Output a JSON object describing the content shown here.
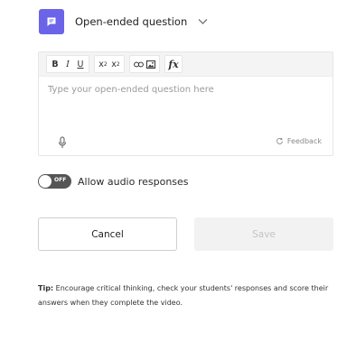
{
  "question_type": {
    "label": "Open-ended question",
    "icon": "speech-bubble-icon",
    "accent": "#6b63e8"
  },
  "toolbar": {
    "bold": "B",
    "italic": "I",
    "underline": "U",
    "superscript": "x",
    "superscript_mark": "2",
    "subscript": "x",
    "subscript_mark": "2",
    "formula": "fx"
  },
  "editor": {
    "placeholder": "Type your open-ended question here",
    "feedback_label": "Feedback"
  },
  "audio_toggle": {
    "state_text": "OFF",
    "label": "Allow audio responses"
  },
  "buttons": {
    "cancel": "Cancel",
    "save": "Save"
  },
  "tip": {
    "prefix": "Tip:",
    "text": " Encourage critical thinking, check your students' responses and score their answers when they complete the video."
  }
}
